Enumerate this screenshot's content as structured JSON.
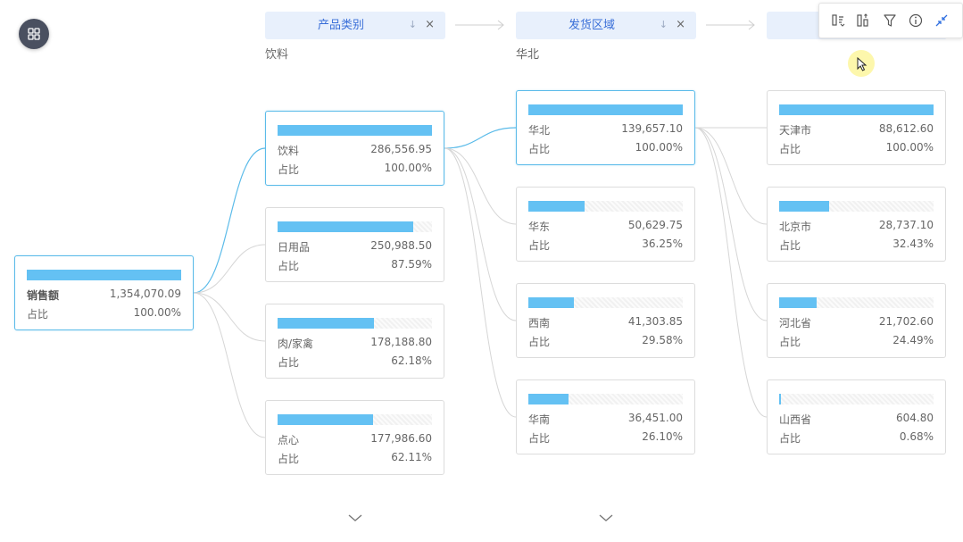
{
  "toolbar": {
    "icons": [
      "sort-switch-icon",
      "bar-compare-icon",
      "filter-icon",
      "info-icon",
      "collapse-icon"
    ]
  },
  "columns": [
    {
      "header": "产品类别",
      "sort_glyph": "↓",
      "close_glyph": "×",
      "crumb": "饮料"
    },
    {
      "header": "发货区域",
      "sort_glyph": "↓",
      "close_glyph": "×",
      "crumb": "华北"
    },
    {
      "header": "",
      "sort_glyph": "",
      "close_glyph": "",
      "crumb": ""
    }
  ],
  "root": {
    "label": "销售额",
    "value": "1,354,070.09",
    "pct_label": "占比",
    "pct": "100.00%",
    "fill": 1.0
  },
  "col1": [
    {
      "label": "饮料",
      "value": "286,556.95",
      "pct_label": "占比",
      "pct": "100.00%",
      "fill": 1.0
    },
    {
      "label": "日用品",
      "value": "250,988.50",
      "pct_label": "占比",
      "pct": "87.59%",
      "fill": 0.8759
    },
    {
      "label": "肉/家禽",
      "value": "178,188.80",
      "pct_label": "占比",
      "pct": "62.18%",
      "fill": 0.6218
    },
    {
      "label": "点心",
      "value": "177,986.60",
      "pct_label": "占比",
      "pct": "62.11%",
      "fill": 0.6211
    }
  ],
  "col2": [
    {
      "label": "华北",
      "value": "139,657.10",
      "pct_label": "占比",
      "pct": "100.00%",
      "fill": 1.0
    },
    {
      "label": "华东",
      "value": "50,629.75",
      "pct_label": "占比",
      "pct": "36.25%",
      "fill": 0.3625
    },
    {
      "label": "西南",
      "value": "41,303.85",
      "pct_label": "占比",
      "pct": "29.58%",
      "fill": 0.2958
    },
    {
      "label": "华南",
      "value": "36,451.00",
      "pct_label": "占比",
      "pct": "26.10%",
      "fill": 0.261
    }
  ],
  "col3": [
    {
      "label": "天津市",
      "value": "88,612.60",
      "pct_label": "占比",
      "pct": "100.00%",
      "fill": 1.0
    },
    {
      "label": "北京市",
      "value": "28,737.10",
      "pct_label": "占比",
      "pct": "32.43%",
      "fill": 0.3243
    },
    {
      "label": "河北省",
      "value": "21,702.60",
      "pct_label": "占比",
      "pct": "24.49%",
      "fill": 0.2449
    },
    {
      "label": "山西省",
      "value": "604.80",
      "pct_label": "占比",
      "pct": "0.68%",
      "fill": 0.0068
    }
  ],
  "colors": {
    "bar": "#64c1f3",
    "active_link": "#5bbbe9",
    "link": "#d6d6d6",
    "header_bg": "#e8f0fc",
    "header_text": "#3a6fd8"
  }
}
